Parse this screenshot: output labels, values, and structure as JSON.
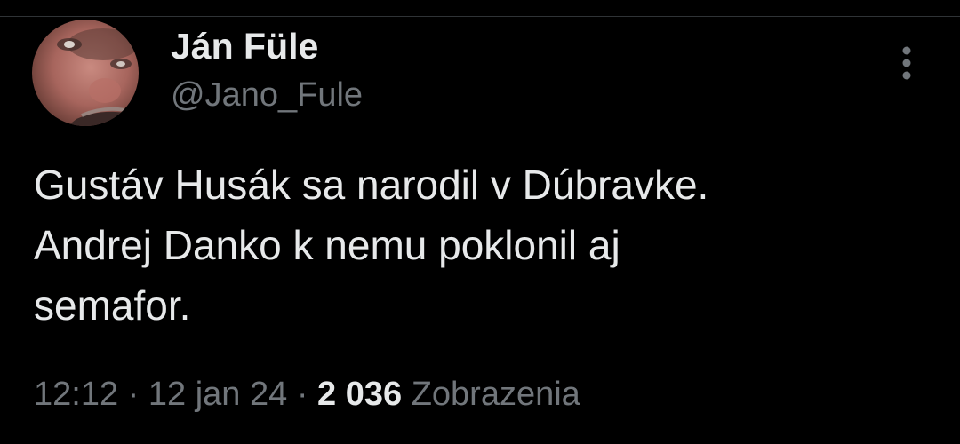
{
  "tweet": {
    "author": {
      "display_name": "Ján Füle",
      "handle": "@Jano_Fule",
      "avatar": "profile-photo"
    },
    "more_icon": "more-vertical-icon",
    "text": "Gustáv Husák sa narodil v Dúbravke.\nAndrej Danko k nemu poklonil aj\nsemafor.",
    "time": "12:12",
    "separator": "·",
    "date": "12 jan 24",
    "views_count": "2 036",
    "views_label": "Zobrazenia"
  },
  "colors": {
    "background": "#000000",
    "text_primary": "#e7e9ea",
    "text_secondary": "#71767b",
    "divider": "#2f3336"
  }
}
